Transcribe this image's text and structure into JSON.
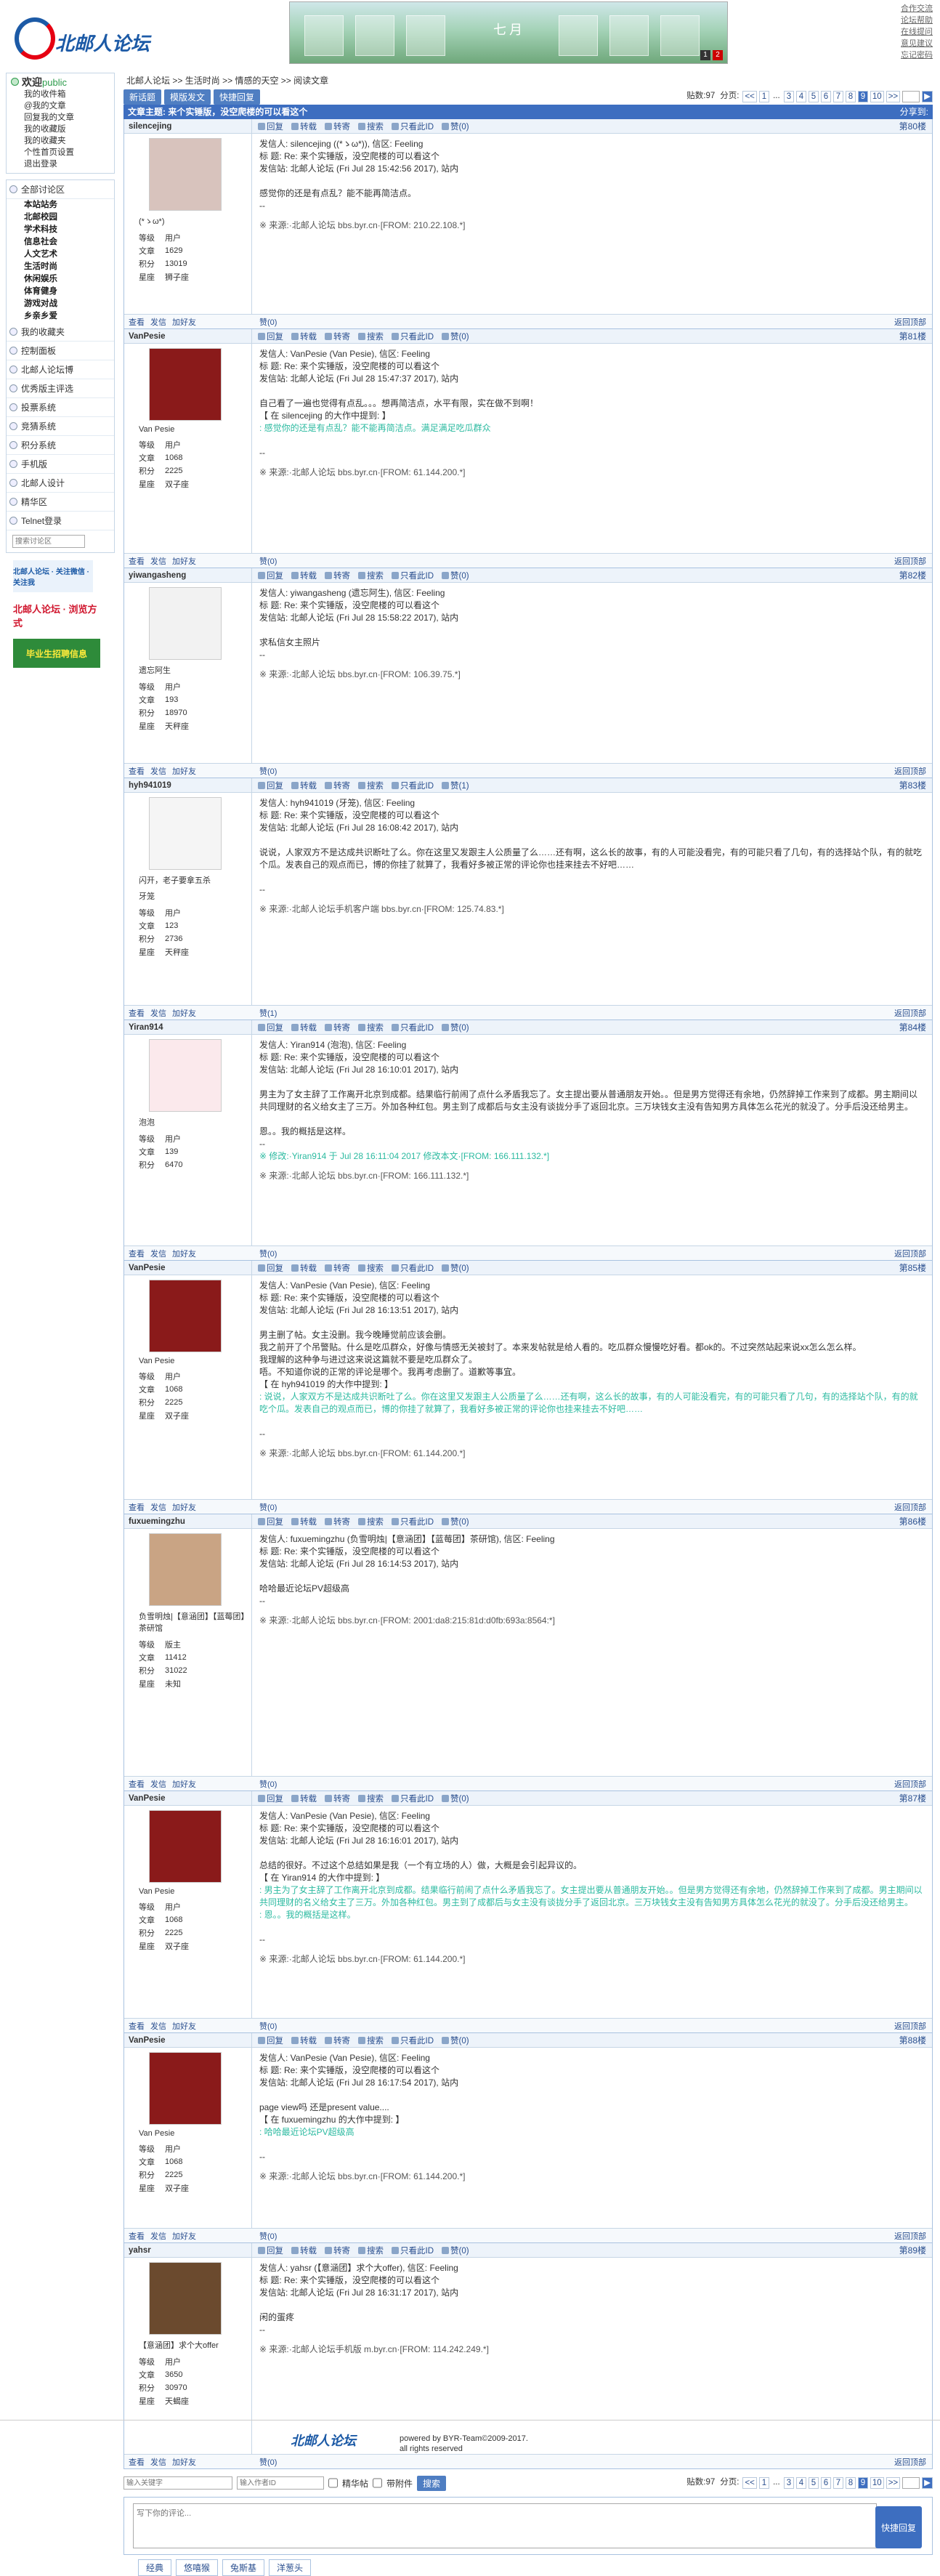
{
  "header": {
    "logo_text": "北邮人论坛",
    "banner_text": "七月",
    "banner_dots": [
      "1",
      "2"
    ],
    "links": [
      "合作交流",
      "论坛帮助",
      "在线提问",
      "意见建议",
      "忘记密码"
    ]
  },
  "sidebar": {
    "welcome": "欢迎",
    "user": "public",
    "links": [
      "我的收件箱",
      "@我的文章",
      "回复我的文章",
      "我的收藏版",
      "我的收藏夹",
      "个性首页设置",
      "退出登录"
    ],
    "menu": [
      "全部讨论区",
      "我的收藏夹",
      "控制面板",
      "北邮人论坛博",
      "优秀版主评选",
      "投票系统",
      "竞猜系统",
      "积分系统",
      "手机版",
      "北邮人设计",
      "精华区",
      "Telnet登录"
    ],
    "subs": [
      "本站站务",
      "北邮校园",
      "学术科技",
      "信息社会",
      "人文艺术",
      "生活时尚",
      "休闲娱乐",
      "体育健身",
      "游戏对战",
      "乡亲乡爱"
    ],
    "search_placeholder": "搜索讨论区",
    "ads": [
      "北邮人论坛 · 关注微信 · 关注我",
      "北邮人论坛 · 浏览方式",
      "毕业生招聘信息"
    ]
  },
  "main": {
    "crumbs": [
      "北邮人论坛",
      ">>",
      "生活时尚",
      ">>",
      "情感的天空",
      ">>",
      "阅读文章"
    ],
    "buttons": [
      "新话题",
      "模版发文",
      "快捷回复"
    ],
    "post_count": "贴数:97",
    "page_label": "分页:",
    "pages": [
      "<<",
      "1",
      "...",
      "3",
      "4",
      "5",
      "6",
      "7",
      "8",
      "9",
      "10",
      ">>"
    ],
    "thread_title": "文章主题: 来个实锤版，没空爬楼的可以看这个",
    "share": "分享到:",
    "actions": [
      "回复",
      "转载",
      "转寄",
      "搜索",
      "只看此ID",
      "赞(0)"
    ],
    "foot_actions": [
      "查看",
      "发信",
      "加好友"
    ],
    "back_top": "返回顶部",
    "posts": [
      {
        "user": "silencejing",
        "nick": "(*ゝω*)",
        "stats": [
          [
            "等级",
            "用户"
          ],
          [
            "文章",
            "1629"
          ],
          [
            "积分",
            "13019"
          ],
          [
            "星座",
            "狮子座"
          ]
        ],
        "like": "赞(0)",
        "floor": "第80楼",
        "lines": [
          "发信人: silencejing ((*ゝω*)), 信区: Feeling",
          "标  题: Re: 来个实锤版，没空爬楼的可以看这个",
          "发信站: 北邮人论坛 (Fri Jul 28 15:42:56 2017), 站内",
          "",
          "感觉你的还是有点乱？能不能再简洁点。",
          "--"
        ],
        "source": "※ 来源:·北邮人论坛 bbs.byr.cn·[FROM: 210.22.108.*]"
      },
      {
        "user": "VanPesie",
        "nick": "Van Pesie",
        "stats": [
          [
            "等级",
            "用户"
          ],
          [
            "文章",
            "1068"
          ],
          [
            "积分",
            "2225"
          ],
          [
            "星座",
            "双子座"
          ]
        ],
        "like": "赞(0)",
        "floor": "第81楼",
        "lines": [
          "发信人: VanPesie (Van Pesie), 信区: Feeling",
          "标  题: Re: 来个实锤版，没空爬楼的可以看这个",
          "发信站: 北邮人论坛 (Fri Jul 28 15:47:37 2017), 站内",
          "",
          "自己看了一遍也觉得有点乱。。。想再简洁点，水平有限，实在做不到啊！",
          "【 在 silencejing 的大作中提到: 】",
          ": 感觉你的还是有点乱？能不能再简洁点。满足满足吃瓜群众",
          "",
          "--"
        ],
        "source": "※ 来源:·北邮人论坛 bbs.byr.cn·[FROM: 61.144.200.*]"
      },
      {
        "user": "yiwangasheng",
        "nick": "遗忘阿生",
        "stats": [
          [
            "等级",
            "用户"
          ],
          [
            "文章",
            "193"
          ],
          [
            "积分",
            "18970"
          ],
          [
            "星座",
            "天秤座"
          ]
        ],
        "like": "赞(0)",
        "floor": "第82楼",
        "lines": [
          "发信人: yiwangasheng (遗忘阿生), 信区: Feeling",
          "标  题: Re: 来个实锤版，没空爬楼的可以看这个",
          "发信站: 北邮人论坛 (Fri Jul 28 15:58:22 2017), 站内",
          "",
          "求私信女主照片",
          "--"
        ],
        "source": "※ 来源:·北邮人论坛 bbs.byr.cn·[FROM: 106.39.75.*]"
      },
      {
        "user": "hyh941019",
        "nick": "闪开，老子要拿五杀",
        "nick2": "牙笼",
        "stats": [
          [
            "等级",
            "用户"
          ],
          [
            "文章",
            "123"
          ],
          [
            "积分",
            "2736"
          ],
          [
            "星座",
            "天秤座"
          ]
        ],
        "like": "赞(1)",
        "floor": "第83楼",
        "lines": [
          "发信人: hyh941019 (牙笼), 信区: Feeling",
          "标  题: Re: 来个实锤版，没空爬楼的可以看这个",
          "发信站: 北邮人论坛 (Fri Jul 28 16:08:42 2017), 站内",
          "",
          "说说，人家双方不是达成共识断吐了么。你在这里又发跟主人公质量了么……还有啊，这么长的故事，有的人可能没看完，有的可能只看了几句，有的选择站个队，有的就吃个瓜。发表自己的观点而已，博的你挂了就算了，我看好多被正常的评论你也挂来挂去不好吧……",
          "",
          "--"
        ],
        "source": "※ 来源:·北邮人论坛手机客户端 bbs.byr.cn·[FROM: 125.74.83.*]"
      },
      {
        "user": "Yiran914",
        "nick": "泡泡",
        "stats": [
          [
            "等级",
            "用户"
          ],
          [
            "文章",
            "139"
          ],
          [
            "积分",
            "6470"
          ]
        ],
        "like": "赞(0)",
        "floor": "第84楼",
        "lines": [
          "发信人: Yiran914 (泡泡), 信区: Feeling",
          "标  题: Re: 来个实锤版，没空爬楼的可以看这个",
          "发信站: 北邮人论坛 (Fri Jul 28 16:10:01 2017), 站内",
          "",
          "男主为了女主辞了工作离开北京到成都。结果临行前闹了点什么矛盾我忘了。女主提出要从普通朋友开始。。但是男方觉得还有余地，仍然辞掉工作来到了成都。男主期间以共同理财的名义给女主了三万。外加各种红包。男主到了成都后与女主没有谈拢分手了返回北京。三万块钱女主没有告知男方具体怎么花光的就没了。分手后没还给男主。",
          "",
          "恩。。我的概括是这样。",
          "--"
        ],
        "edit": "※ 修改:·Yiran914 于 Jul 28 16:11:04 2017 修改本文·[FROM: 166.111.132.*]",
        "source": "※ 来源:·北邮人论坛 bbs.byr.cn·[FROM: 166.111.132.*]"
      },
      {
        "user": "VanPesie",
        "nick": "Van Pesie",
        "stats": [
          [
            "等级",
            "用户"
          ],
          [
            "文章",
            "1068"
          ],
          [
            "积分",
            "2225"
          ],
          [
            "星座",
            "双子座"
          ]
        ],
        "like": "赞(0)",
        "floor": "第85楼",
        "lines": [
          "发信人: VanPesie (Van Pesie), 信区: Feeling",
          "标  题: Re: 来个实锤版，没空爬楼的可以看这个",
          "发信站: 北邮人论坛 (Fri Jul 28 16:13:51 2017), 站内",
          "",
          "男主删了帖。女主没删。我今晚睡觉前应该会删。",
          "我之前开了个吊警贴。什么是吃瓜群众，好像与情感无关被封了。本来发帖就是给人看的。吃瓜群众慢慢吃好看。都ok的。不过突然站起来说xx怎么怎么样。",
          "我理解的这种争与进过这来说这篇就不要是吃瓜群众了。",
          "唔。不知道你说的正常的评论是哪个。我再考虑删了。道歉等事宜。",
          "【 在 hyh941019 的大作中提到: 】",
          ": 说说，人家双方不是达成共识断吐了么。你在这里又发跟主人公质量了么……还有啊，这么长的故事，有的人可能没看完，有的可能只看了几句，有的选择站个队，有的就吃个瓜。发表自己的观点而已，博的你挂了就算了，我看好多被正常的评论你也挂来挂去不好吧……",
          "",
          "--"
        ],
        "source": "※ 来源:·北邮人论坛 bbs.byr.cn·[FROM: 61.144.200.*]"
      },
      {
        "user": "fuxuemingzhu",
        "nick": "负雪明烛|【意涵团】【蓝莓团】茶研馆",
        "stats": [
          [
            "等级",
            "版主"
          ],
          [
            "文章",
            "11412"
          ],
          [
            "积分",
            "31022"
          ],
          [
            "星座",
            "未知"
          ]
        ],
        "like": "赞(0)",
        "floor": "第86楼",
        "lines": [
          "发信人: fuxuemingzhu (负雪明烛|【意涵团】【蓝莓团】茶研馆), 信区: Feeling",
          "标  题: Re: 来个实锤版，没空爬楼的可以看这个",
          "发信站: 北邮人论坛 (Fri Jul 28 16:14:53 2017), 站内",
          "",
          "哈哈最近论坛PV超级高",
          "--"
        ],
        "source": "※ 来源:·北邮人论坛 bbs.byr.cn·[FROM: 2001:da8:215:81d:d0fb:693a:8564:*]"
      },
      {
        "user": "VanPesie",
        "nick": "Van Pesie",
        "stats": [
          [
            "等级",
            "用户"
          ],
          [
            "文章",
            "1068"
          ],
          [
            "积分",
            "2225"
          ],
          [
            "星座",
            "双子座"
          ]
        ],
        "like": "赞(0)",
        "floor": "第87楼",
        "lines": [
          "发信人: VanPesie (Van Pesie), 信区: Feeling",
          "标  题: Re: 来个实锤版，没空爬楼的可以看这个",
          "发信站: 北邮人论坛 (Fri Jul 28 16:16:01 2017), 站内",
          "",
          "总结的很好。不过这个总结如果是我（一个有立场的人）做，大概是会引起异议的。",
          "【 在 Yiran914 的大作中提到: 】",
          ": 男主为了女主辞了工作离开北京到成都。结果临行前闹了点什么矛盾我忘了。女主提出要从普通朋友开始。。但是男方觉得还有余地，仍然辞掉工作来到了成都。男主期间以共同理财的名义给女主了三万。外加各种红包。男主到了成都后与女主没有谈拢分手了返回北京。三万块钱女主没有告知男方具体怎么花光的就没了。分手后没还给男主。",
          ": 恩。。我的概括是这样。",
          "",
          "--"
        ],
        "source": "※ 来源:·北邮人论坛 bbs.byr.cn·[FROM: 61.144.200.*]"
      },
      {
        "user": "VanPesie",
        "nick": "Van Pesie",
        "stats": [
          [
            "等级",
            "用户"
          ],
          [
            "文章",
            "1068"
          ],
          [
            "积分",
            "2225"
          ],
          [
            "星座",
            "双子座"
          ]
        ],
        "like": "赞(0)",
        "floor": "第88楼",
        "lines": [
          "发信人: VanPesie (Van Pesie), 信区: Feeling",
          "标  题: Re: 来个实锤版，没空爬楼的可以看这个",
          "发信站: 北邮人论坛 (Fri Jul 28 16:17:54 2017), 站内",
          "",
          "page view吗 还是present value....",
          "【 在 fuxuemingzhu 的大作中提到: 】",
          ": 哈哈最近论坛PV超级高",
          "",
          "--"
        ],
        "source": "※ 来源:·北邮人论坛 bbs.byr.cn·[FROM: 61.144.200.*]"
      },
      {
        "user": "yahsr",
        "nick": "【意涵团】求个大offer",
        "stats": [
          [
            "等级",
            "用户"
          ],
          [
            "文章",
            "3650"
          ],
          [
            "积分",
            "30970"
          ],
          [
            "星座",
            "天蝎座"
          ]
        ],
        "like": "赞(0)",
        "floor": "第89楼",
        "lines": [
          "发信人: yahsr (【意涵团】求个大offer), 信区: Feeling",
          "标  题: Re: 来个实锤版，没空爬楼的可以看这个",
          "发信站: 北邮人论坛 (Fri Jul 28 16:31:17 2017), 站内",
          "",
          "闲的蛋疼",
          "--"
        ],
        "source": "※ 来源:·北邮人论坛手机版 m.byr.cn·[FROM: 114.242.249.*]"
      }
    ],
    "bottom": {
      "search_kw": "输入关键字",
      "search_id": "输入作者ID",
      "chk1": "精华帖",
      "chk2": "带附件",
      "search_btn": "搜索",
      "reply_placeholder": "写下你的评论...",
      "reply_btn": "快捷回复",
      "tabs": [
        "经典",
        "悠嘻猴",
        "兔斯基",
        "洋葱头"
      ]
    }
  },
  "footer": {
    "logo": "北邮人论坛",
    "powered": "powered by BYR-Team©2009-2017.",
    "rights": "all rights reserved"
  }
}
